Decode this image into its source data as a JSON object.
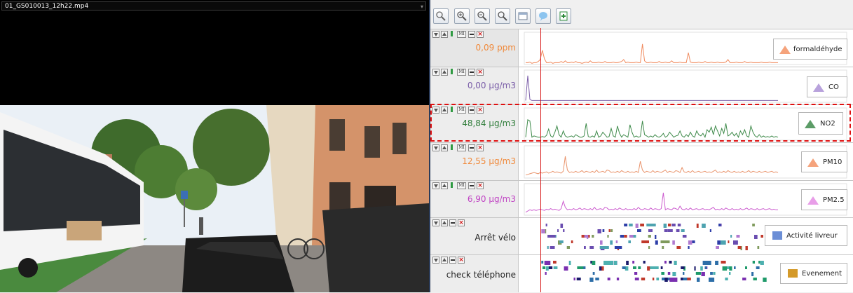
{
  "video": {
    "filename": "01_GS010013_12h22.mp4"
  },
  "toolbar": {
    "buttons": [
      {
        "icon": "zoom-reset-icon"
      },
      {
        "icon": "zoom-in-icon"
      },
      {
        "icon": "zoom-out-icon"
      },
      {
        "icon": "zoom-icon"
      },
      {
        "icon": "window-icon"
      },
      {
        "icon": "speech-bubble-icon"
      },
      {
        "icon": "export-icon"
      }
    ]
  },
  "tracks": [
    {
      "id": "formaldehyde",
      "value": "0,09 ppm",
      "legend": "formaldéhyde",
      "color": "#f08a5d",
      "legend_color": "#f5a37c",
      "series": [
        50,
        50,
        49,
        51,
        50,
        50,
        48,
        45,
        30,
        44,
        50,
        50,
        49,
        51,
        50,
        50,
        50,
        48,
        50,
        47,
        50,
        50,
        49,
        50,
        48,
        50,
        50,
        51,
        50,
        49,
        50,
        47,
        50,
        50,
        50,
        49,
        50,
        50,
        48,
        50,
        50,
        50,
        49,
        50,
        50,
        49,
        48,
        45,
        50,
        49,
        50,
        50,
        50,
        49,
        50,
        50,
        20,
        47,
        50,
        50,
        49,
        50,
        50,
        50,
        48,
        50,
        50,
        49,
        50,
        50,
        47,
        50,
        50,
        50,
        49,
        50,
        50,
        50,
        34,
        49,
        50,
        50,
        50,
        49,
        50,
        50,
        48,
        50,
        50,
        49,
        50,
        50,
        49,
        50,
        50,
        50,
        49,
        45,
        50,
        50,
        50,
        49,
        50,
        50,
        50,
        48,
        50,
        50,
        49,
        50,
        50,
        50,
        50,
        49,
        50,
        50,
        50,
        49,
        50,
        50,
        50,
        50
      ]
    },
    {
      "id": "co",
      "value": "0,00 µg/m3",
      "legend": "CO",
      "color": "#7a5da8",
      "legend_color": "#b8a2dc",
      "series": [
        50,
        10,
        48,
        50,
        50,
        50,
        50,
        50,
        50,
        50,
        50,
        50,
        50,
        50,
        50,
        50,
        50,
        50,
        50,
        50,
        50,
        50,
        50,
        50,
        50,
        50,
        50,
        50,
        50,
        50,
        50,
        50,
        50,
        50,
        50,
        50,
        50,
        50,
        50,
        50,
        50,
        50,
        50,
        50,
        50,
        50,
        50,
        50,
        50,
        50,
        50,
        50,
        50,
        50,
        50,
        50,
        50,
        50,
        50,
        50,
        50,
        50,
        50,
        50,
        50,
        50,
        50,
        50,
        50,
        50,
        50,
        50,
        50,
        50,
        50,
        50,
        50,
        50,
        50,
        50,
        50,
        50,
        50,
        50,
        50,
        50,
        50,
        50,
        50,
        50,
        50,
        50,
        50,
        50,
        50,
        50,
        50,
        50,
        50,
        50,
        50,
        50,
        50,
        50,
        50,
        50,
        50,
        50,
        50,
        50,
        50,
        50,
        50,
        50,
        50,
        50,
        50,
        50,
        50,
        50,
        50,
        50
      ]
    },
    {
      "id": "no2",
      "value": "48,84 µg/m3",
      "legend": "NO2",
      "color": "#3e8a4a",
      "legend_color": "#5c9c67",
      "series": [
        48,
        20,
        22,
        48,
        46,
        47,
        48,
        48,
        47,
        48,
        45,
        35,
        46,
        48,
        40,
        30,
        44,
        48,
        38,
        46,
        48,
        47,
        46,
        48,
        44,
        46,
        48,
        48,
        46,
        26,
        47,
        48,
        46,
        48,
        38,
        48,
        46,
        40,
        44,
        48,
        47,
        34,
        46,
        48,
        30,
        42,
        48,
        44,
        46,
        48,
        28,
        40,
        48,
        46,
        48,
        47,
        22,
        44,
        46,
        48,
        46,
        48,
        44,
        47,
        48,
        46,
        42,
        48,
        46,
        40,
        44,
        48,
        46,
        45,
        38,
        46,
        48,
        44,
        47,
        40,
        46,
        48,
        38,
        44,
        46,
        42,
        48,
        36,
        40,
        32,
        44,
        30,
        38,
        46,
        34,
        42,
        26,
        46,
        44,
        40,
        46,
        42,
        48,
        38,
        44,
        36,
        46,
        48,
        30,
        40,
        46,
        48,
        44,
        48,
        46,
        48,
        47,
        48,
        46,
        48,
        47,
        48
      ]
    },
    {
      "id": "pm10",
      "value": "12,55 µg/m3",
      "legend": "PM10",
      "color": "#e9946c",
      "legend_color": "#f5a37c",
      "series": [
        48,
        47,
        46,
        45,
        44,
        45,
        46,
        44,
        45,
        44,
        43,
        45,
        44,
        42,
        44,
        43,
        44,
        45,
        42,
        18,
        40,
        44,
        43,
        44,
        42,
        44,
        43,
        41,
        44,
        42,
        43,
        44,
        42,
        44,
        40,
        44,
        43,
        42,
        44,
        40,
        41,
        44,
        43,
        44,
        42,
        44,
        41,
        43,
        44,
        42,
        44,
        43,
        44,
        42,
        44,
        26,
        40,
        44,
        42,
        43,
        44,
        41,
        44,
        42,
        43,
        44,
        42,
        40,
        44,
        42,
        43,
        44,
        41,
        42,
        44,
        36,
        43,
        44,
        42,
        44,
        41,
        44,
        43,
        42,
        44,
        43,
        42,
        44,
        43,
        44,
        42,
        40,
        44,
        43,
        44,
        42,
        44,
        41,
        43,
        44,
        42,
        44,
        43,
        44,
        42,
        44,
        43,
        41,
        44,
        42,
        43,
        44,
        42,
        44,
        43,
        42,
        44,
        43,
        42,
        44,
        43,
        44
      ]
    },
    {
      "id": "pm25",
      "value": "6,90 µg/m3",
      "legend": "PM2.5",
      "color": "#cc5ccf",
      "legend_color": "#e89ee8",
      "series": [
        48,
        46,
        44,
        45,
        44,
        45,
        44,
        43,
        44,
        45,
        43,
        44,
        42,
        44,
        43,
        44,
        45,
        42,
        30,
        40,
        44,
        43,
        44,
        42,
        44,
        43,
        41,
        44,
        42,
        43,
        44,
        42,
        44,
        40,
        44,
        43,
        42,
        44,
        40,
        41,
        44,
        43,
        44,
        42,
        44,
        41,
        43,
        44,
        42,
        44,
        43,
        44,
        42,
        44,
        40,
        43,
        44,
        42,
        43,
        44,
        41,
        44,
        42,
        43,
        44,
        42,
        16,
        44,
        42,
        43,
        44,
        41,
        42,
        44,
        38,
        43,
        44,
        42,
        44,
        41,
        44,
        43,
        42,
        44,
        43,
        42,
        44,
        43,
        44,
        42,
        40,
        44,
        43,
        44,
        42,
        44,
        41,
        43,
        44,
        42,
        44,
        43,
        44,
        42,
        44,
        43,
        41,
        44,
        42,
        43,
        44,
        42,
        44,
        43,
        42,
        44,
        43,
        42,
        44,
        43,
        44,
        44
      ]
    },
    {
      "id": "arret",
      "label": "Arrêt vélo",
      "legend": "Activité livreur",
      "legend_color": "#6b8ed6"
    },
    {
      "id": "check",
      "label": "check téléphone",
      "legend": "Evenement",
      "legend_color": "#d49a2a"
    }
  ],
  "controls": {
    "mi": "MI"
  }
}
